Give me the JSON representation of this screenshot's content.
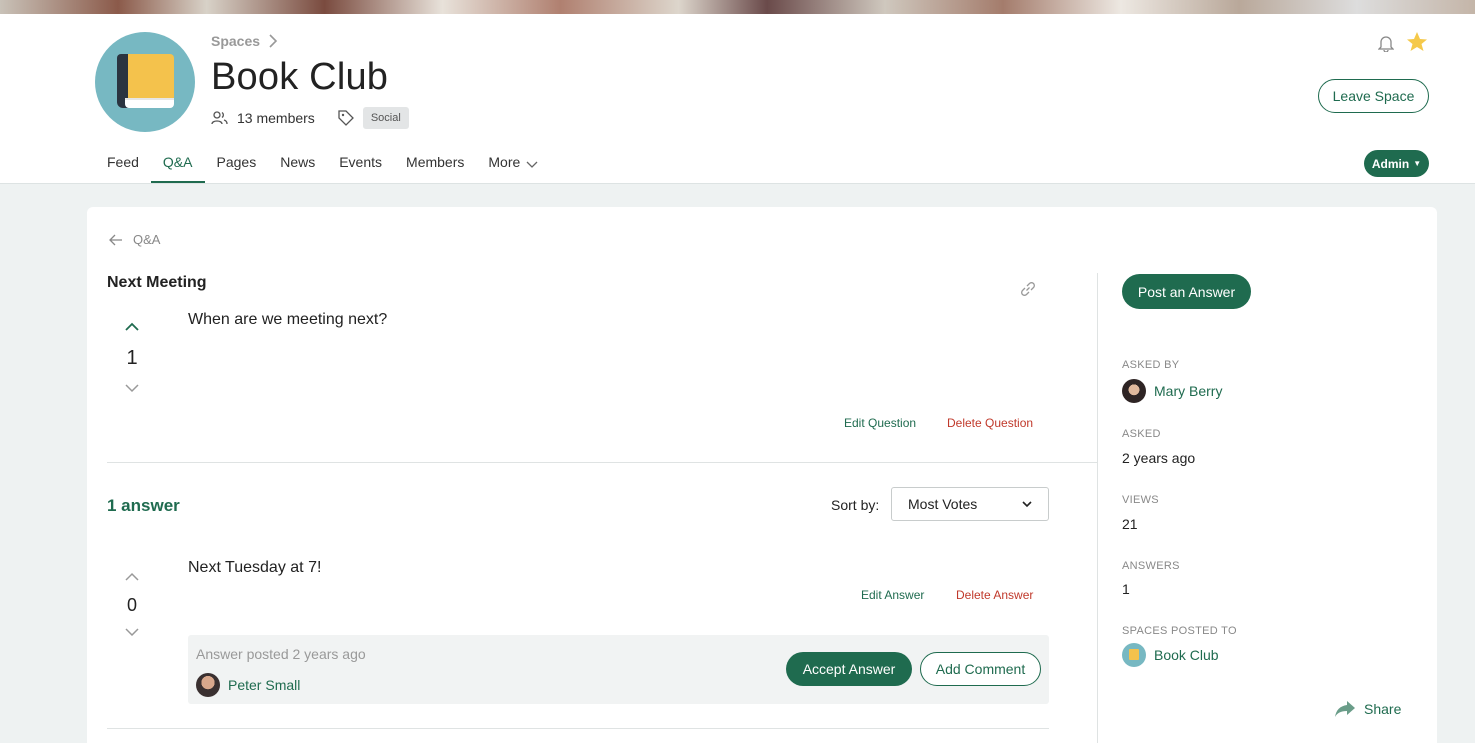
{
  "header": {
    "breadcrumb": "Spaces",
    "space_title": "Book Club",
    "members": "13 members",
    "tag": "Social",
    "leave_label": "Leave Space",
    "admin_label": "Admin"
  },
  "tabs": [
    {
      "label": "Feed"
    },
    {
      "label": "Q&A"
    },
    {
      "label": "Pages"
    },
    {
      "label": "News"
    },
    {
      "label": "Events"
    },
    {
      "label": "Members"
    },
    {
      "label": "More"
    }
  ],
  "question": {
    "back_label": "Q&A",
    "title": "Next Meeting",
    "body": "When are we meeting next?",
    "votes": "1",
    "edit_label": "Edit Question",
    "delete_label": "Delete Question"
  },
  "answers_section": {
    "count_label": "1 answer",
    "sort_label": "Sort by:",
    "sort_value": "Most Votes"
  },
  "answer": {
    "body": "Next Tuesday at 7!",
    "votes": "0",
    "edit_label": "Edit Answer",
    "delete_label": "Delete Answer",
    "posted": "Answer posted 2 years ago",
    "author": "Peter Small",
    "accept_label": "Accept Answer",
    "comment_label": "Add Comment"
  },
  "sidebar": {
    "post_answer_label": "Post an Answer",
    "asked_by_label": "ASKED BY",
    "asked_by": "Mary Berry",
    "asked_label": "ASKED",
    "asked": "2 years ago",
    "views_label": "VIEWS",
    "views": "21",
    "answers_label": "ANSWERS",
    "answers": "1",
    "spaces_label": "SPACES POSTED TO",
    "space": "Book Club",
    "share_label": "Share"
  },
  "colors": {
    "accent": "#1f6b4f",
    "danger": "#c0392b",
    "star": "#f5c94a"
  }
}
